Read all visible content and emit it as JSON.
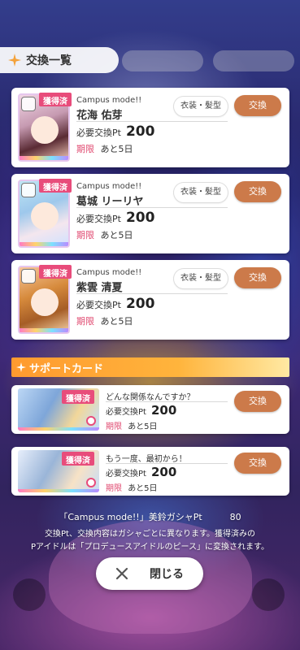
{
  "header": {
    "title": "交換一覧"
  },
  "idol_cards": [
    {
      "obtained": "獲得済",
      "source": "Campus mode!!",
      "name": "花海 佑芽",
      "category": "衣装・髪型",
      "pt_label": "必要交換Pt",
      "pt_value": "200",
      "limit_label": "期限",
      "limit_value": "あと5日",
      "button": "交換"
    },
    {
      "obtained": "獲得済",
      "source": "Campus mode!!",
      "name": "葛城 リーリヤ",
      "category": "衣装・髪型",
      "pt_label": "必要交換Pt",
      "pt_value": "200",
      "limit_label": "期限",
      "limit_value": "あと5日",
      "button": "交換"
    },
    {
      "obtained": "獲得済",
      "source": "Campus mode!!",
      "name": "紫雲 清夏",
      "category": "衣装・髪型",
      "pt_label": "必要交換Pt",
      "pt_value": "200",
      "limit_label": "期限",
      "limit_value": "あと5日",
      "button": "交換"
    }
  ],
  "support_section": {
    "title": "サポートカード"
  },
  "support_cards": [
    {
      "obtained": "獲得済",
      "title": "どんな関係なんですか？",
      "pt_label": "必要交換Pt",
      "pt_value": "200",
      "limit_label": "期限",
      "limit_value": "あと5日",
      "button": "交換"
    },
    {
      "obtained": "獲得済",
      "title": "もう一度、最初から！",
      "pt_label": "必要交換Pt",
      "pt_value": "200",
      "limit_label": "期限",
      "limit_value": "あと5日",
      "button": "交換"
    }
  ],
  "footer": {
    "pt_name": "「Campus mode!!」美鈴ガシャPt",
    "pt_amount": "80",
    "note_line1": "交換Pt、交換内容はガシャごとに異なります。獲得済みの",
    "note_line2": "Pアイドルは「プロデュースアイドルのピース」に変換されます。",
    "close_label": "閉じる"
  },
  "colors": {
    "exchange_button": "#cc7a4a",
    "obtained_badge": "#e84c7b",
    "section_header": "#ff9a2f",
    "limit_label": "#e0486f"
  }
}
